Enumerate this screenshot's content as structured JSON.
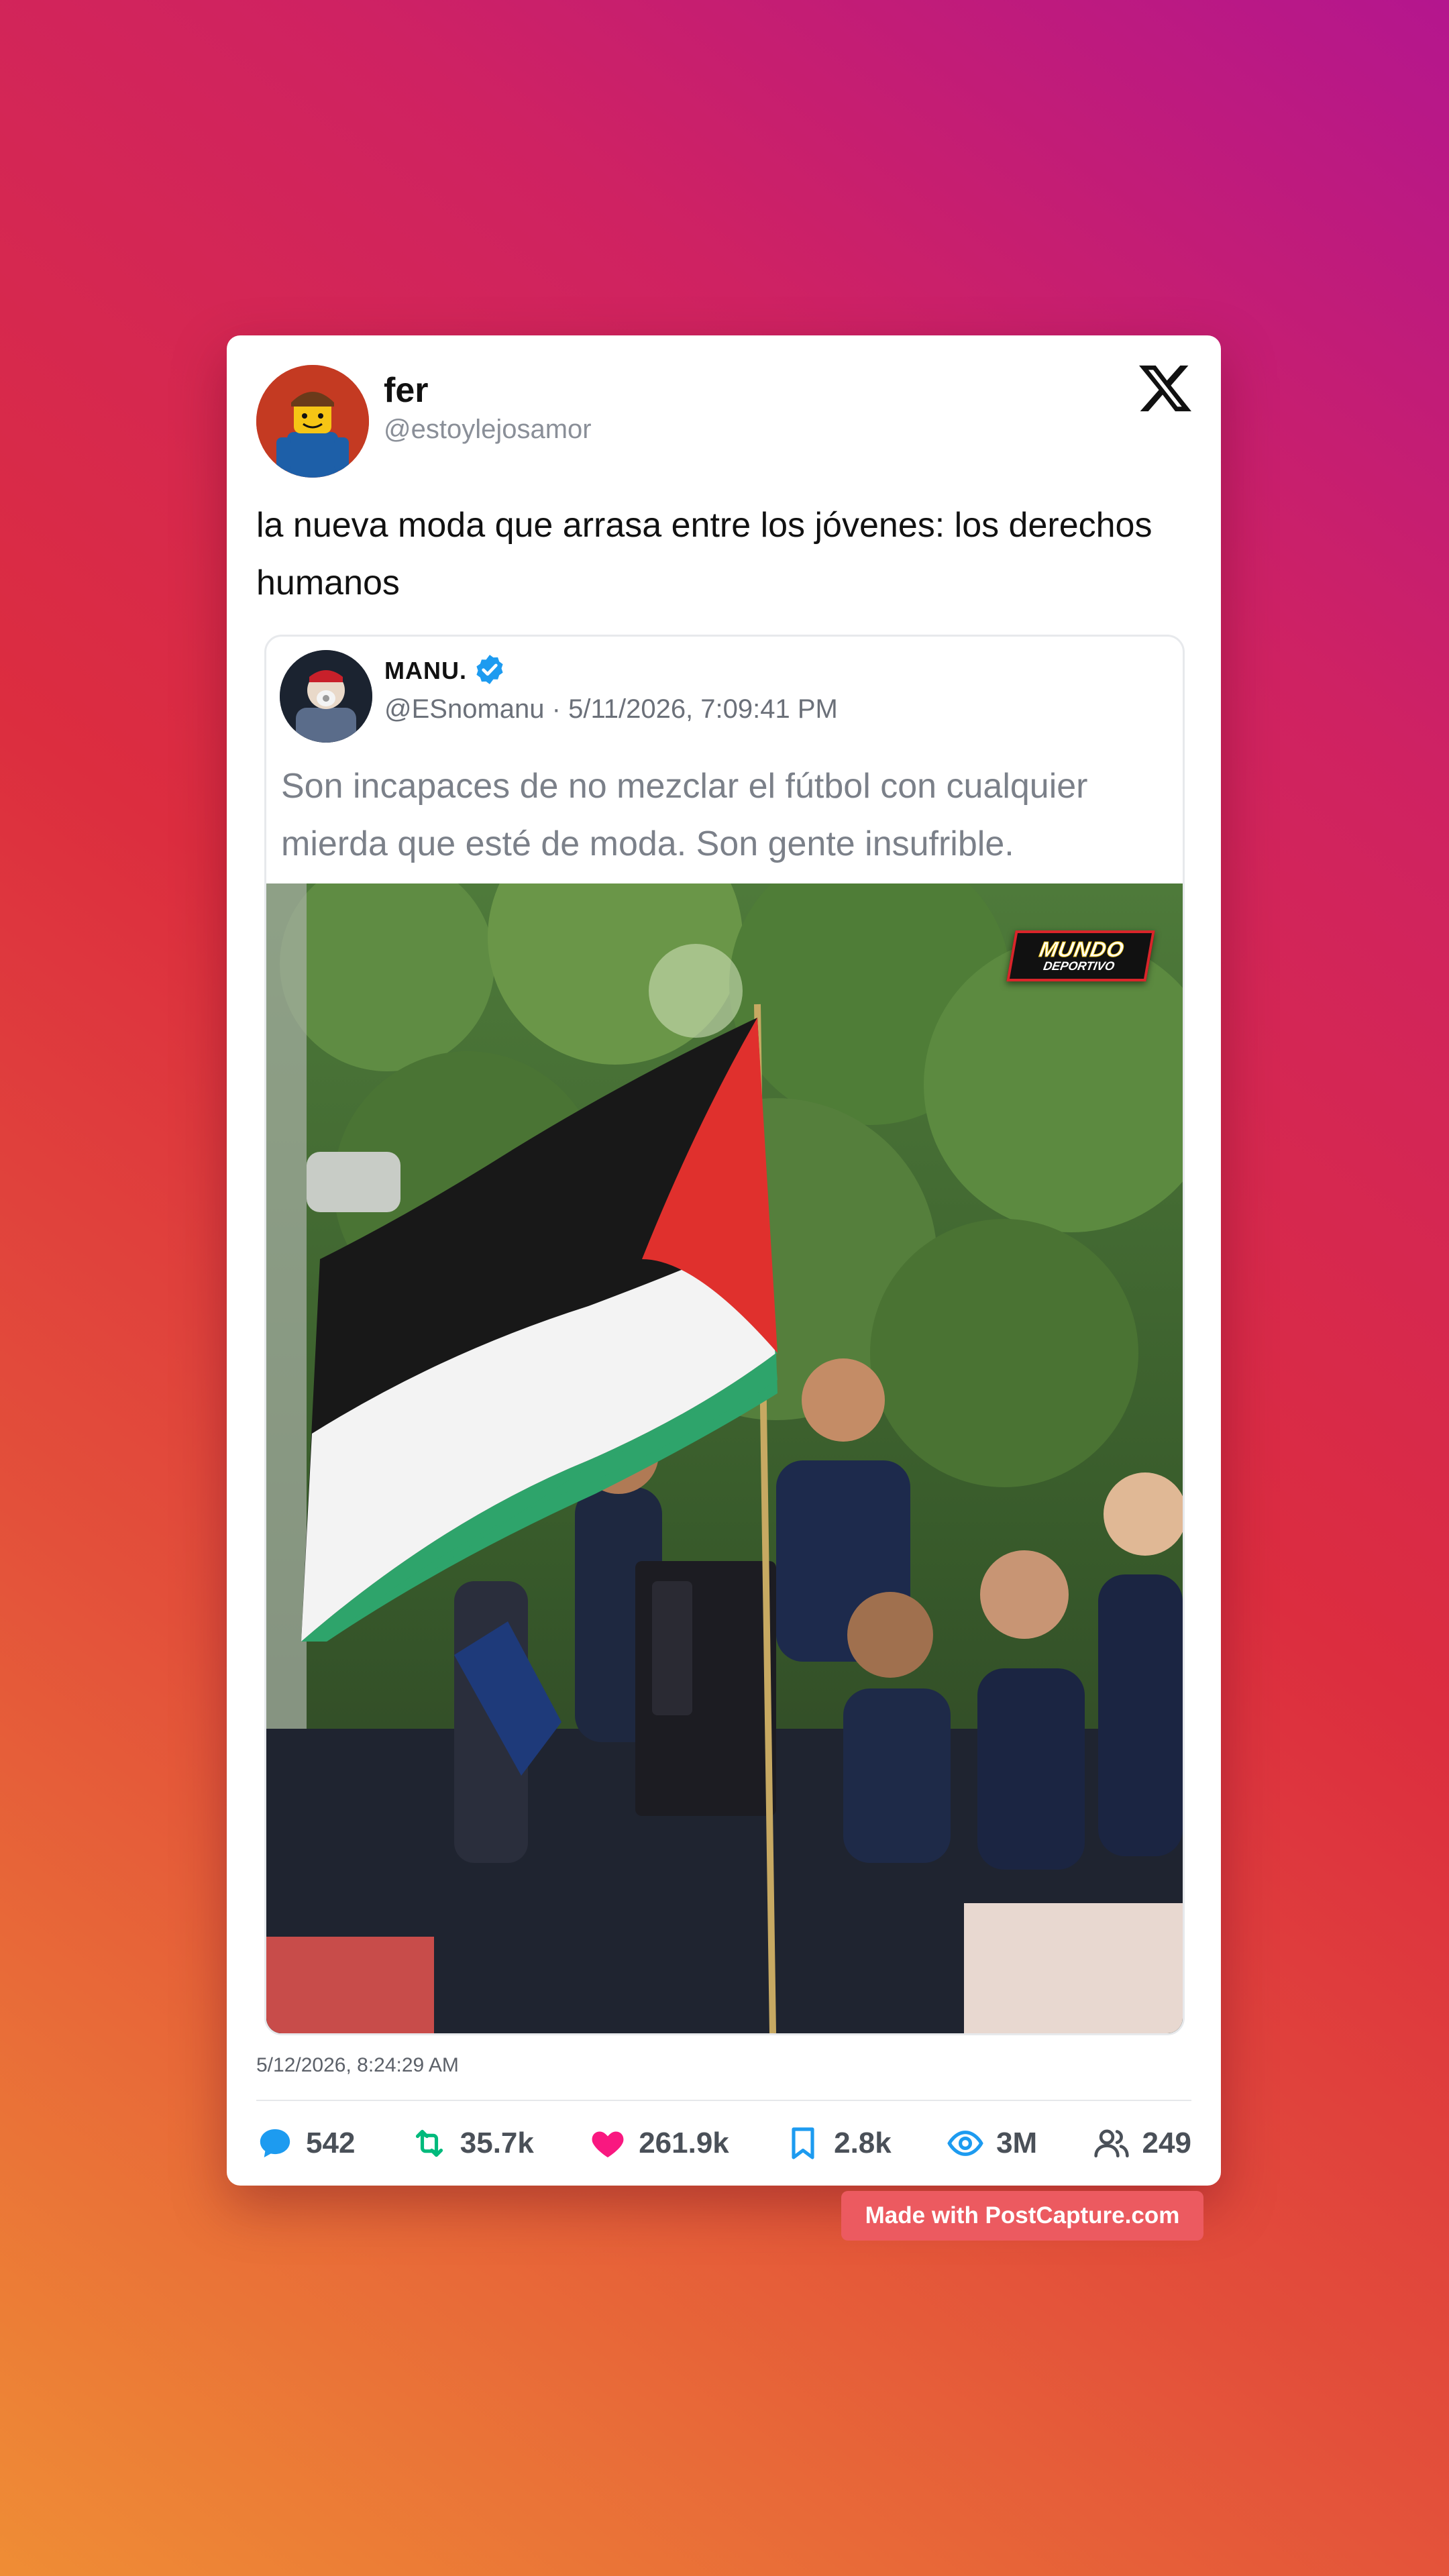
{
  "app": "X",
  "tweet": {
    "author_name": "fer",
    "author_handle": "@estoylejosamor",
    "text": "la nueva moda que arrasa entre los jóvenes: los derechos humanos",
    "timestamp": "5/12/2026, 8:24:29 AM",
    "icons": {
      "avatar": "lego-figure-avatar",
      "brand": "x-logo-icon"
    }
  },
  "quoted_tweet": {
    "author_name": "MANU.",
    "verified": true,
    "author_handle": "@ESnomanu",
    "date": "5/11/2026, 7:09:41 PM",
    "text": "Son incapaces de no mezclar el fútbol con cualquier mierda que esté de moda. Son gente insufrible.",
    "media": {
      "watermark_line1": "MUNDO",
      "watermark_line2": "DEPORTIVO",
      "flag_colors": [
        "#1a1a1a",
        "#f4f4f4",
        "#2ea46b",
        "#e0302d"
      ]
    }
  },
  "stats": [
    {
      "icon": "reply-icon",
      "value": "542",
      "color": "#1d9bf0"
    },
    {
      "icon": "retweet-icon",
      "value": "35.7k",
      "color": "#00ba7c"
    },
    {
      "icon": "like-icon",
      "value": "261.9k",
      "color": "#f91880"
    },
    {
      "icon": "bookmark-icon",
      "value": "2.8k",
      "color": "#1d9bf0"
    },
    {
      "icon": "views-icon",
      "value": "3M",
      "color": "#1d9bf0"
    },
    {
      "icon": "followers-icon",
      "value": "249",
      "color": "#4a5058"
    }
  ],
  "footer_badge": "Made with PostCapture.com",
  "colors": {
    "verified": "#1d9bf0",
    "badge": "#ec5a60"
  }
}
